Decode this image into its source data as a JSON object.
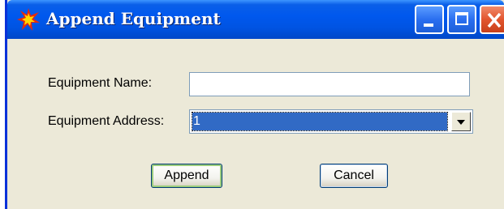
{
  "window": {
    "title": "Append Equipment",
    "icon": "starburst-icon"
  },
  "titlebar_buttons": [
    "minimize",
    "maximize",
    "close"
  ],
  "form": {
    "name_label": "Equipment Name:",
    "name_value": "",
    "address_label": "Equipment Address:",
    "address_selected": "1"
  },
  "buttons": {
    "append": "Append",
    "cancel": "Cancel"
  },
  "colors": {
    "titlebar": "#0054e3",
    "window_bg": "#ece9d8",
    "selection": "#316ac5",
    "close_button": "#e2552e"
  }
}
